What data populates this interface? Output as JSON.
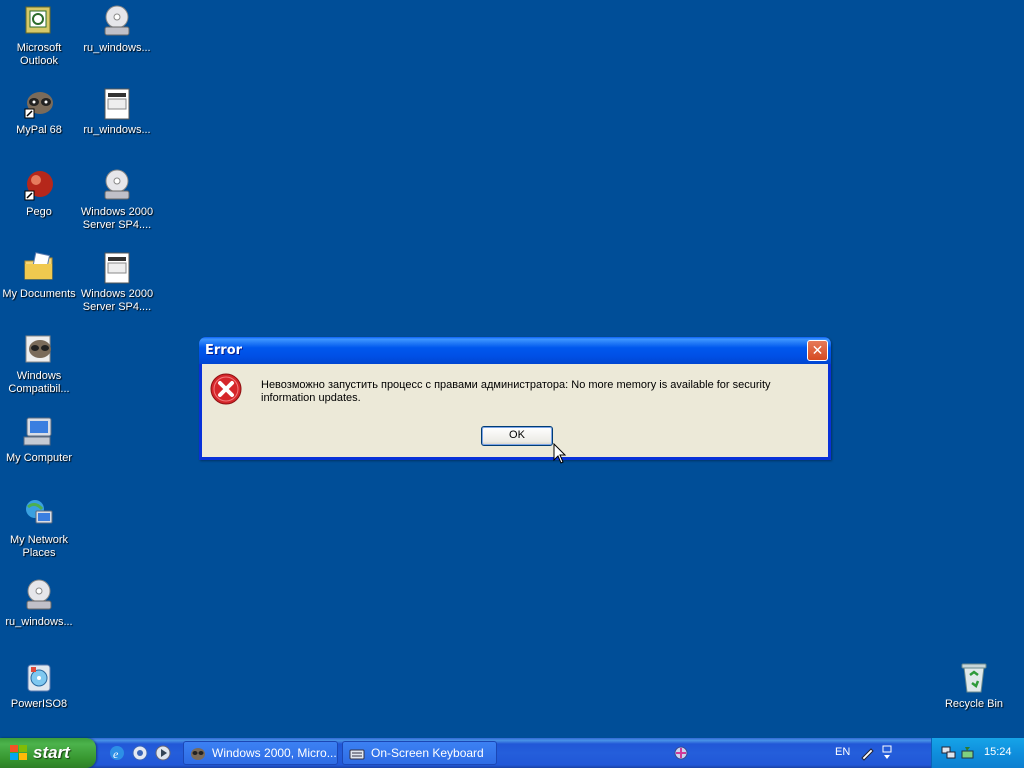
{
  "desktop": {
    "icons": [
      {
        "label": "Microsoft Outlook",
        "icon": "outlook-icon"
      },
      {
        "label": "ru_windows...",
        "icon": "cd-drive-icon"
      },
      {
        "label": "MyPal 68",
        "icon": "mypal-raccoon-icon"
      },
      {
        "label": "ru_windows...",
        "icon": "document-window-icon"
      },
      {
        "label": "Pego",
        "icon": "pego-red-ball-icon"
      },
      {
        "label": "Windows 2000 Server SP4....",
        "icon": "cd-drive-icon"
      },
      {
        "label": "My Documents",
        "icon": "folder-icon"
      },
      {
        "label": "Windows 2000 Server SP4....",
        "icon": "document-window-icon"
      },
      {
        "label": "Windows Compatibil...",
        "icon": "raccoon-icon"
      },
      {
        "label": "My Computer",
        "icon": "computer-icon"
      },
      {
        "label": "My Network Places",
        "icon": "network-icon"
      },
      {
        "label": "ru_windows...",
        "icon": "cd-drive-icon"
      },
      {
        "label": "PowerISO8",
        "icon": "poweriso-icon"
      },
      {
        "label": "Recycle Bin",
        "icon": "recycle-bin-icon"
      }
    ]
  },
  "dialog": {
    "title": "Error",
    "close_label": "✕",
    "message": "Невозможно запустить процесс с правами администратора: No more memory is available for security information updates.",
    "ok_label": "OK",
    "icon": "error-icon"
  },
  "taskbar": {
    "start_label": "start",
    "quick_launch": [
      "ie-icon",
      "firefox-icon",
      "media-player-icon"
    ],
    "tasks": [
      {
        "label": "Windows 2000, Micro...",
        "icon": "raccoon-icon"
      },
      {
        "label": "On-Screen Keyboard",
        "icon": "keyboard-icon"
      }
    ],
    "language": "EN",
    "clock": "15:24"
  },
  "colors": {
    "desktop": "#004e98",
    "titlebar": "#0058ee",
    "dialog_body": "#ece9d8",
    "start_green": "#3c9f3c",
    "error_red": "#d5262a"
  }
}
